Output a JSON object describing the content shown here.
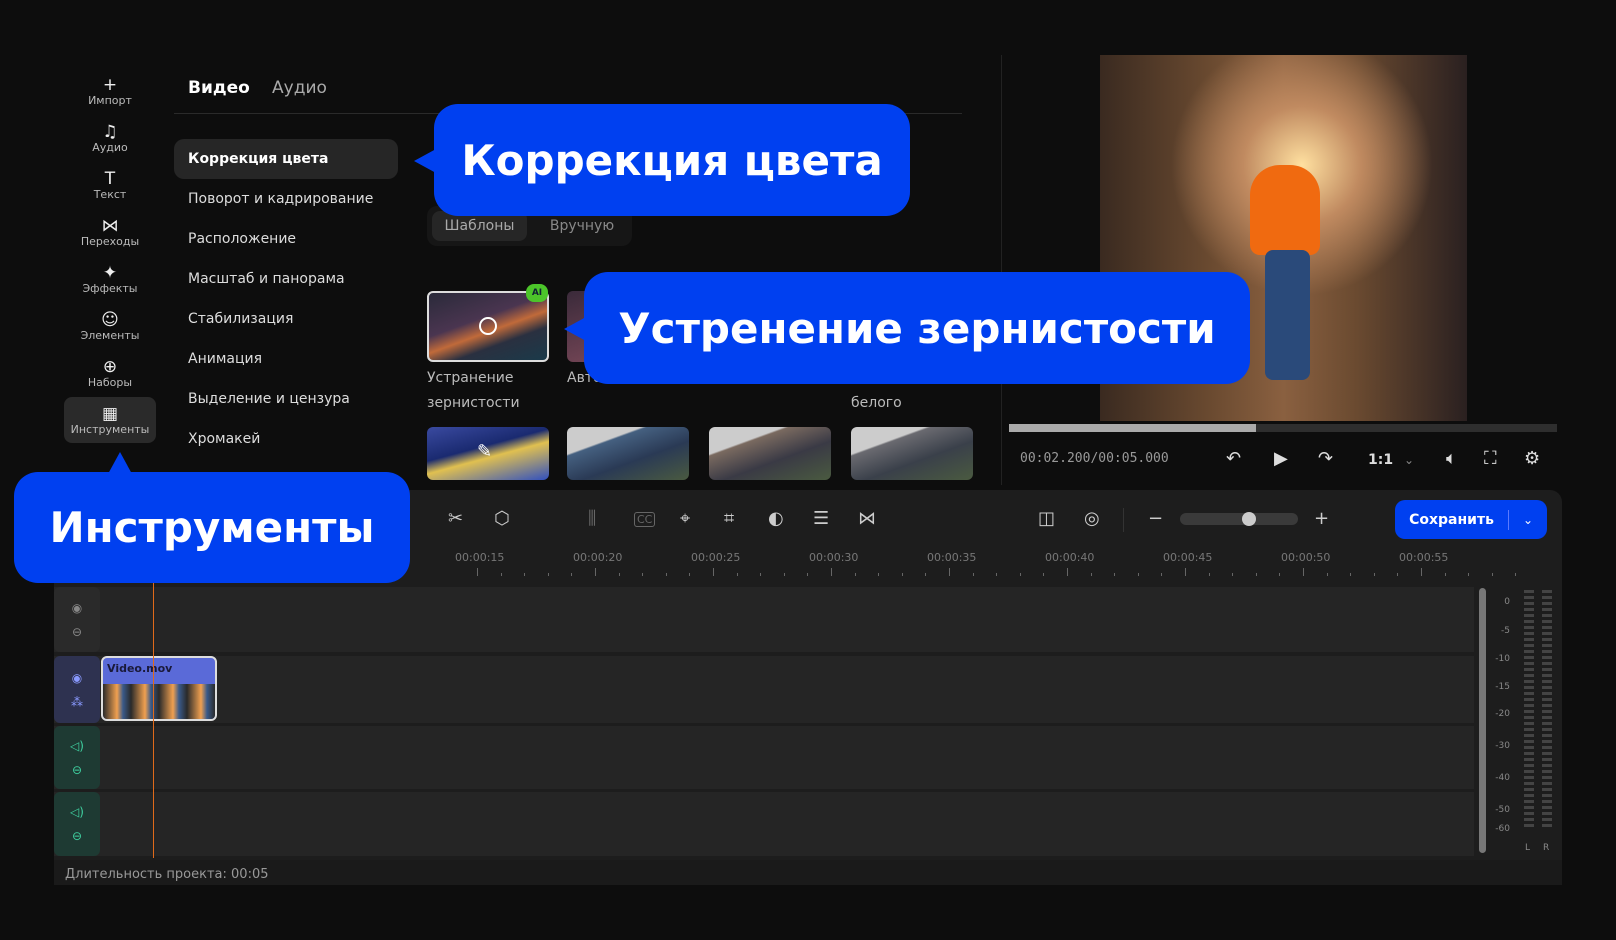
{
  "sidebar": {
    "items": [
      {
        "icon": "plus-icon",
        "glyph": "+",
        "label": "Импорт"
      },
      {
        "icon": "music-icon",
        "glyph": "♫",
        "label": "Аудио"
      },
      {
        "icon": "text-icon",
        "glyph": "T",
        "label": "Текст"
      },
      {
        "icon": "transitions-icon",
        "glyph": "⋈",
        "label": "Переходы"
      },
      {
        "icon": "effects-icon",
        "glyph": "✦",
        "label": "Эффекты"
      },
      {
        "icon": "smiley-icon",
        "glyph": "☺",
        "label": "Элементы"
      },
      {
        "icon": "bag-icon",
        "glyph": "⊕",
        "label": "Наборы"
      },
      {
        "icon": "tools-icon",
        "glyph": "▦",
        "label": "Инструменты"
      }
    ]
  },
  "tabs": {
    "video": "Видео",
    "audio": "Аудио"
  },
  "menu": [
    "Коррекция цвета",
    "Поворот и кадрирование",
    "Расположение",
    "Масштаб и панорама",
    "Стабилизация",
    "Анимация",
    "Выделение и цензура",
    "Хромакей"
  ],
  "segmented": {
    "templates": "Шаблоны",
    "manual": "Вручную"
  },
  "presets": {
    "ai_badge": "AI",
    "first_line1": "Устранение",
    "first_line2": "зернистости",
    "second": "Авто",
    "fourth_line2": "белого"
  },
  "callouts": {
    "color": "Коррекция цвета",
    "grain": "Устренение зернистости",
    "tools": "Инструменты"
  },
  "player": {
    "time": "00:02.200/00:05.000",
    "ratio": "1:1",
    "progress": 0.45
  },
  "toolbar": {
    "save": "Сохранить",
    "zoom": 0.6
  },
  "ruler": [
    "00:00:15",
    "00:00:20",
    "00:00:25",
    "00:00:30",
    "00:00:35",
    "00:00:40",
    "00:00:45",
    "00:00:50",
    "00:00:55"
  ],
  "clip": {
    "name": "Video.mov"
  },
  "meter": {
    "ticks": [
      "0",
      "-5",
      "-10",
      "-15",
      "-20",
      "-30",
      "-40",
      "-50",
      "-60"
    ],
    "left": "L",
    "right": "R"
  },
  "status": "Длительность проекта: 00:05",
  "colors": {
    "accent": "#0040f0",
    "playhead": "#e06a1a",
    "audio_track": "#1e3a33",
    "video_track": "#2e3250"
  }
}
